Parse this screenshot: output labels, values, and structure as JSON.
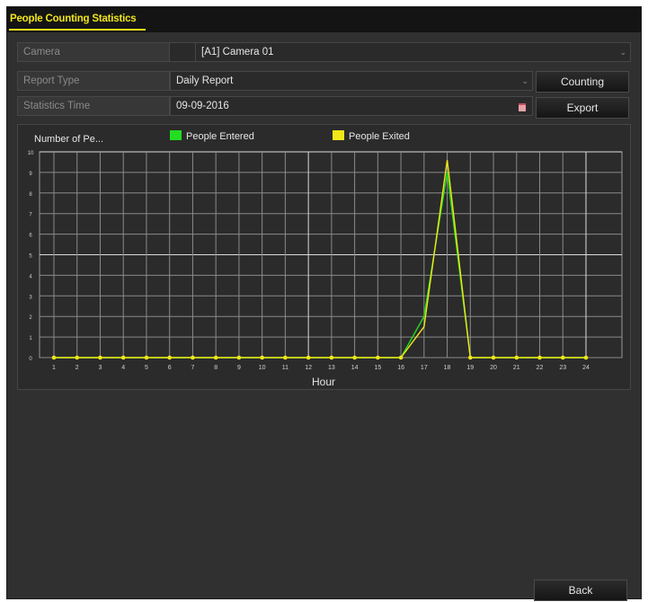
{
  "tab": {
    "title": "People Counting Statistics"
  },
  "form": {
    "camera_label": "Camera",
    "camera_value": "[A1] Camera 01",
    "report_type_label": "Report Type",
    "report_type_value": "Daily Report",
    "stats_time_label": "Statistics Time",
    "stats_time_value": "09-09-2016"
  },
  "buttons": {
    "counting": "Counting",
    "export": "Export",
    "back": "Back"
  },
  "chart_data": {
    "type": "line",
    "ylabel": "Number of Pe...",
    "xlabel": "Hour",
    "x": [
      1,
      2,
      3,
      4,
      5,
      6,
      7,
      8,
      9,
      10,
      11,
      12,
      13,
      14,
      15,
      16,
      17,
      18,
      19,
      20,
      21,
      22,
      23,
      24
    ],
    "x_tick_labels": [
      "1",
      "2",
      "3",
      "4",
      "5",
      "6",
      "7",
      "8",
      "9",
      "10",
      "11",
      "12",
      "13",
      "14",
      "15",
      "16",
      "17",
      "18",
      "19",
      "20",
      "21",
      "22",
      "23",
      "24"
    ],
    "ylim": [
      0,
      10
    ],
    "y_ticks": [
      0,
      1,
      2,
      3,
      4,
      5,
      6,
      7,
      8,
      9,
      10
    ],
    "grid": true,
    "legend_placement": "top",
    "series": [
      {
        "name": "People Entered",
        "color": "#22dd22",
        "values": [
          0,
          0,
          0,
          0,
          0,
          0,
          0,
          0,
          0,
          0,
          0,
          0,
          0,
          0,
          0,
          0,
          2,
          9,
          0,
          0,
          0,
          0,
          0,
          0
        ]
      },
      {
        "name": "People Exited",
        "color": "#f0e61a",
        "values": [
          0,
          0,
          0,
          0,
          0,
          0,
          0,
          0,
          0,
          0,
          0,
          0,
          0,
          0,
          0,
          0,
          1.5,
          9.6,
          0,
          0,
          0,
          0,
          0,
          0
        ]
      }
    ]
  }
}
